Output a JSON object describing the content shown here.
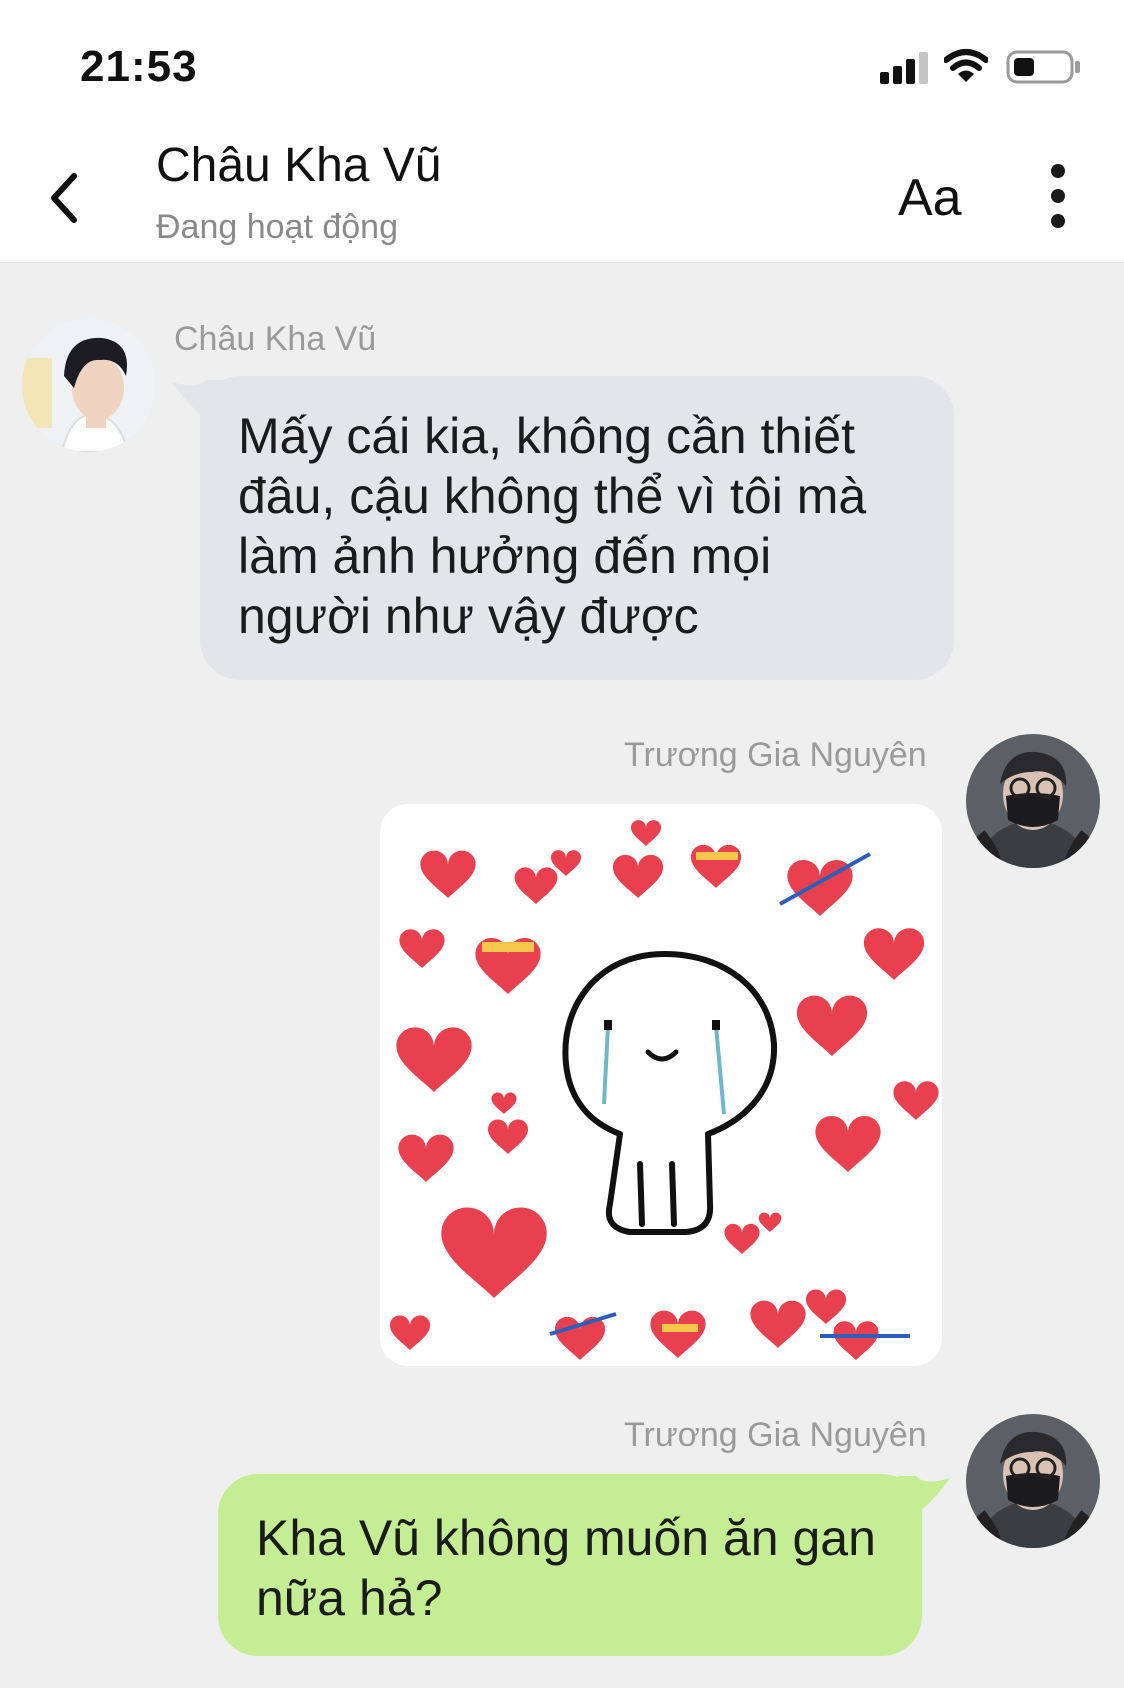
{
  "status_bar": {
    "time": "21:53",
    "signal_icon": "cellular-signal-icon",
    "wifi_icon": "wifi-icon",
    "battery_icon": "battery-icon",
    "battery_level": 0.35
  },
  "header": {
    "back_icon": "chevron-left-icon",
    "contact_name": "Châu Kha Vũ",
    "contact_status": "Đang hoạt động",
    "font_button_label": "Aa",
    "more_icon": "vertical-ellipsis-icon"
  },
  "messages": [
    {
      "sender": "Châu Kha Vũ",
      "side": "left",
      "type": "text",
      "text": "Mấy cái kia, không cần thiết đâu, cậu không thể vì tôi mà làm ảnh hưởng đến mọi người như vậy được"
    },
    {
      "sender": "Trương Gia Nguyên",
      "side": "right",
      "type": "sticker",
      "sticker": "crying-smiley-with-hearts-sticker"
    },
    {
      "sender": "Trương Gia Nguyên",
      "side": "right",
      "type": "text",
      "text": "Kha Vũ không muốn ăn gan nữa hả?"
    }
  ],
  "colors": {
    "background": "#efefef",
    "left_bubble": "#e3e5e8",
    "right_bubble": "#c5ee94",
    "heart": "#e8404f"
  }
}
